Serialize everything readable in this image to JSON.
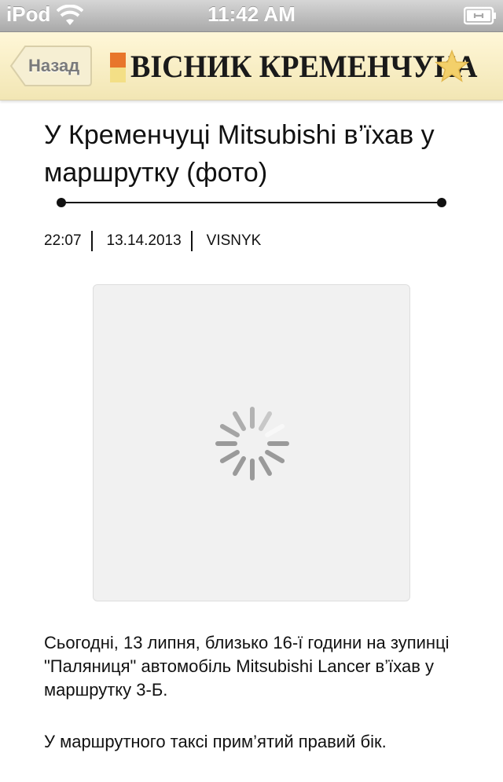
{
  "status_bar": {
    "carrier": "iPod",
    "time": "11:42 AM"
  },
  "nav": {
    "back_label": "Назад",
    "logo_text": "ВІСНИК КРЕМЕНЧУКА",
    "icons": {
      "back": "back-arrow-button",
      "bookmark": "star-icon"
    }
  },
  "article": {
    "title": "У Кременчуці Mitsubishi в’їхав у маршрутку (фото)",
    "time": "22:07",
    "date": "13.14.2013",
    "author": "VISNYK",
    "image_state": "loading",
    "paragraphs": [
      "Сьогодні, 13 липня, близько 16-ї години на зупинці \"Паляниця\" автомобіль Mitsubishi Lancer в’їхав у маршрутку 3-Б.",
      "У маршрутного таксі прим’ятий правий бік."
    ]
  },
  "colors": {
    "nav_bg": "#f2e6b4",
    "logo_orange": "#e8762b",
    "logo_yellow": "#f3df86",
    "star": "#f0c85a"
  }
}
